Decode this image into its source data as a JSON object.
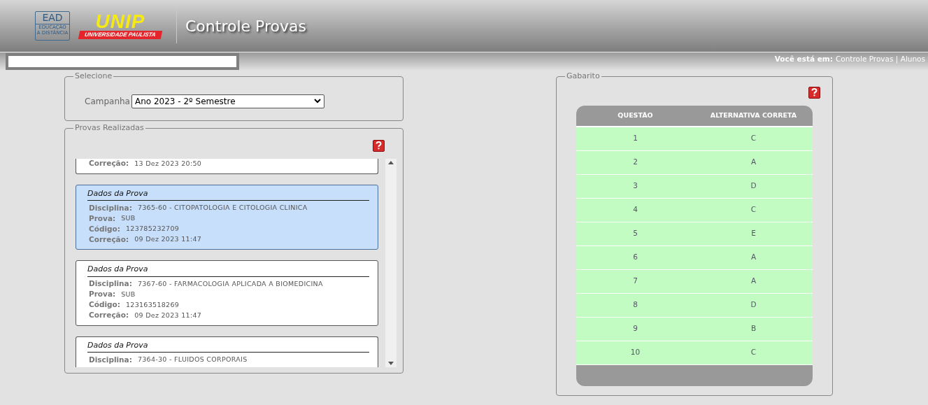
{
  "header": {
    "ead_logo": "EAD",
    "ead_subtitle": "EDUCAÇÃO A DISTÂNCIA",
    "unip_logo": "UNIP",
    "unip_subtitle": "UNIVERSIDADE PAULISTA",
    "title": "Controle Provas"
  },
  "breadcrumb": {
    "label": "Você está em:",
    "path": "Controle Provas | Alunos"
  },
  "selecione": {
    "legend": "Selecione",
    "field_label": "Campanha",
    "value": "Ano 2023 - 2º Semestre"
  },
  "provas": {
    "legend": "Provas Realizadas",
    "cards": [
      {
        "cut_top": true,
        "cut_bottom": false,
        "selected": false,
        "fields": [
          {
            "label": "Correção:",
            "value": "13 Dez 2023 20:50"
          }
        ]
      },
      {
        "cut_top": false,
        "cut_bottom": false,
        "selected": true,
        "title": "Dados da Prova",
        "fields": [
          {
            "label": "Disciplina:",
            "value": "7365-60 - CITOPATOLOGIA E CITOLOGIA CLINICA"
          },
          {
            "label": "Prova:",
            "value": "SUB"
          },
          {
            "label": "Código:",
            "value": "123785232709"
          },
          {
            "label": "Correção:",
            "value": "09 Dez 2023 11:47"
          }
        ]
      },
      {
        "cut_top": false,
        "cut_bottom": false,
        "selected": false,
        "title": "Dados da Prova",
        "fields": [
          {
            "label": "Disciplina:",
            "value": "7367-60 - FARMACOLOGIA APLICADA A BIOMEDICINA"
          },
          {
            "label": "Prova:",
            "value": "SUB"
          },
          {
            "label": "Código:",
            "value": "123163518269"
          },
          {
            "label": "Correção:",
            "value": "09 Dez 2023 11:47"
          }
        ]
      },
      {
        "cut_top": false,
        "cut_bottom": true,
        "selected": false,
        "title": "Dados da Prova",
        "fields": [
          {
            "label": "Disciplina:",
            "value": "7364-30 - FLUIDOS CORPORAIS"
          }
        ]
      }
    ]
  },
  "gabarito": {
    "legend": "Gabarito",
    "columns": [
      "QUESTÃO",
      "ALTERNATIVA CORRETA"
    ],
    "rows": [
      [
        "1",
        "C"
      ],
      [
        "2",
        "A"
      ],
      [
        "3",
        "D"
      ],
      [
        "4",
        "C"
      ],
      [
        "5",
        "E"
      ],
      [
        "6",
        "A"
      ],
      [
        "7",
        "A"
      ],
      [
        "8",
        "D"
      ],
      [
        "9",
        "B"
      ],
      [
        "10",
        "C"
      ]
    ]
  }
}
